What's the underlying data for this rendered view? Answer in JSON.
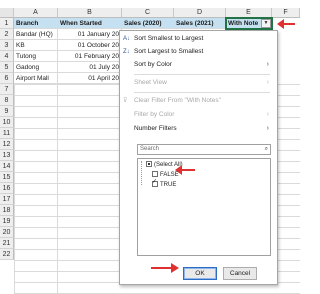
{
  "columns": [
    "A",
    "B",
    "C",
    "D",
    "E",
    "F"
  ],
  "rows": [
    "1",
    "2",
    "3",
    "4",
    "5",
    "6",
    "7",
    "8",
    "9",
    "10",
    "11",
    "12",
    "13",
    "14",
    "15",
    "16",
    "17",
    "18",
    "19",
    "20",
    "21",
    "22"
  ],
  "headers": {
    "branch": "Branch",
    "when_started": "When Started",
    "sales_2020": "Sales (2020)",
    "sales_2021": "Sales (2021)",
    "with_notes": "With Note"
  },
  "data_rows": [
    {
      "branch": "Bandar (HQ)",
      "when_started": "01 January 20"
    },
    {
      "branch": "KB",
      "when_started": "01 October 20"
    },
    {
      "branch": "Tutong",
      "when_started": "01 February 20"
    },
    {
      "branch": "Gadong",
      "when_started": "01 July 20"
    },
    {
      "branch": "Airport Mall",
      "when_started": "01 April 20"
    }
  ],
  "menu": {
    "sort_asc": "Sort Smallest to Largest",
    "sort_desc": "Sort Largest to Smallest",
    "sort_by_color": "Sort by Color",
    "sheet_view": "Sheet View",
    "clear_filter": "Clear Filter From \"With Notes\"",
    "filter_by_color": "Filter by Color",
    "number_filters": "Number Filters",
    "search_placeholder": "Search",
    "list": [
      {
        "label": "(Select All)",
        "state": "partial"
      },
      {
        "label": "FALSE",
        "state": "unchecked"
      },
      {
        "label": "TRUE",
        "state": "checked"
      }
    ],
    "ok": "OK",
    "cancel": "Cancel"
  },
  "colors": {
    "header_fill": "#c5e0f0",
    "selection": "#217346",
    "annotation_arrow": "#e03131"
  }
}
